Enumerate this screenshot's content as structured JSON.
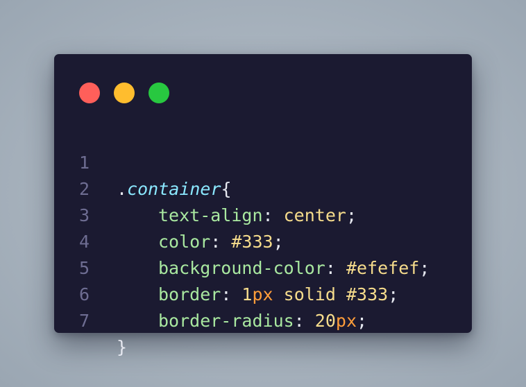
{
  "window": {
    "controls": [
      {
        "name": "close",
        "color": "#ff5f5a"
      },
      {
        "name": "minimize",
        "color": "#ffbd2e"
      },
      {
        "name": "maximize",
        "color": "#28c840"
      }
    ]
  },
  "colors": {
    "background": "#1b1a31",
    "line_number": "#6e6d92",
    "selector": "#8be8ff",
    "property": "#a9e8a0",
    "value": "#f6dc8c",
    "unit": "#ff9d3a",
    "punctuation": "#e6e8f0"
  },
  "code": {
    "line_numbers": [
      "1",
      "2",
      "3",
      "4",
      "5",
      "6",
      "7"
    ],
    "selector_dot": ".",
    "selector_name": "container",
    "open_brace": "{",
    "close_brace": "}",
    "colon": ": ",
    "semicolon": ";",
    "space": " ",
    "rules": {
      "text_align": {
        "property": "text-align",
        "value": "center"
      },
      "color": {
        "property": "color",
        "value": "#333"
      },
      "background_color": {
        "property": "background-color",
        "value": "#efefef"
      },
      "border": {
        "property": "border",
        "number": "1",
        "unit": "px",
        "style": "solid",
        "color": "#333"
      },
      "border_radius": {
        "property": "border-radius",
        "number": "20",
        "unit": "px"
      }
    }
  }
}
